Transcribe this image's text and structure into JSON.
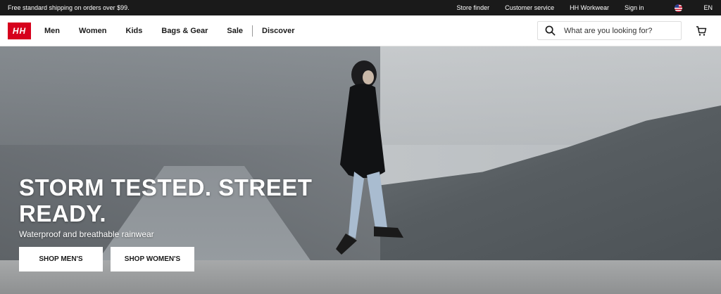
{
  "topbar": {
    "promo": "Free standard shipping on orders over $99.",
    "links": [
      "Store finder",
      "Customer service",
      "HH Workwear",
      "Sign in"
    ],
    "language": "EN"
  },
  "nav": {
    "logo": "HH",
    "items": [
      "Men",
      "Women",
      "Kids",
      "Bags & Gear",
      "Sale",
      "Discover"
    ]
  },
  "search": {
    "placeholder": "What are you looking for?"
  },
  "hero": {
    "title_line1": "STORM TESTED. STREET",
    "title_line2": "READY.",
    "subtitle": "Waterproof and breathable rainwear",
    "button_men": "SHOP MEN'S",
    "button_women": "SHOP WOMEN'S"
  },
  "colors": {
    "brand": "#d6001c",
    "topbar": "#1a1a1a"
  }
}
